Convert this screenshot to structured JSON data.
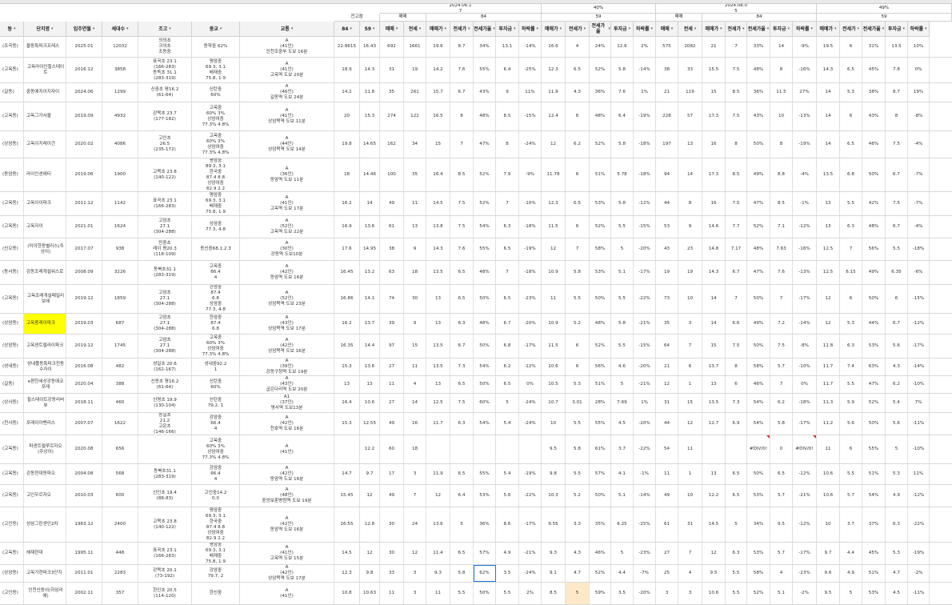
{
  "header": {
    "row1": {
      "date_left": "2024.06.1\n7",
      "pct_left": "40%",
      "date_right": "2024.08.0\n5",
      "pct_right": "49%"
    },
    "row2": {
      "unit": "전고점",
      "trade1": "매매",
      "v84a": "84",
      "v59a": "59",
      "trade2": "매매",
      "v84b": "84",
      "v59b": "59"
    },
    "columns": [
      "동",
      "단지명",
      "입주연월",
      "세대수",
      "조고",
      "중교",
      "교통",
      "84",
      "59",
      "매매",
      "전세",
      "매매가",
      "전세가",
      "전세가율",
      "투자금",
      "하락률",
      "매매가",
      "전세가",
      "전세가율",
      "투자금",
      "하락률",
      "매매",
      "전세",
      "매매가",
      "전세가",
      "전세가율",
      "투자금",
      "하락률",
      "매매가",
      "전세가",
      "전세가율",
      "투자금",
      "하락률"
    ]
  },
  "rows": [
    [
      "(조곡동)",
      "율동특파크프레스",
      "2025.01",
      "12032",
      "의의초\n크의초\n조동중",
      "동학중 62%",
      "A\n(41인)\n인천조중부 도보 16분",
      "22.8615",
      "16.43",
      "692",
      "1661",
      "19.6",
      "8.7",
      "34%",
      "13.1",
      "-14%",
      "16.6",
      "4",
      "24%",
      "12.6",
      "2%",
      "575",
      "2082",
      "21",
      "7",
      "33%",
      "14",
      "-9%",
      "19.5",
      "6",
      "31%",
      "13.5",
      "10%"
    ],
    [
      "(고옥동)",
      "고옥라이인힐스테이트",
      "2016.12",
      "3858",
      "표곡초 23.1\n(166-283)\n동독초 31.1\n(283-319)",
      "평암중\n69.3, 3.1\n배재중\n75.8, 1.9",
      "A\n(41인)\n고옥역 도보 20분",
      "18.9",
      "14.3",
      "31",
      "19",
      "14.2",
      "7.6",
      "55%",
      "6.4",
      "-25%",
      "12.3",
      "6.5",
      "52%",
      "5.8",
      "-14%",
      "38",
      "33",
      "15.5",
      "7.5",
      "48%",
      "8",
      "-16%",
      "14.3",
      "6.5",
      "45%",
      "7.8",
      "0%"
    ],
    [
      "(길동)",
      "중동예지이지자이",
      "2024.06",
      "1299",
      "신중초 평16.2\n(61-64)",
      "신탄중\n60%",
      "A\n(46인)\n길동역 도보 24분",
      "14.2",
      "11.8",
      "35",
      "261",
      "15.7",
      "6.7",
      "43%",
      "9",
      "11%",
      "11.9",
      "4.3",
      "36%",
      "7.6",
      "1%",
      "21",
      "119",
      "15",
      "8.5",
      "36%",
      "11.5",
      "27%",
      "14",
      "5.3",
      "38%",
      "8.7",
      "19%"
    ],
    [
      "(고옥동)",
      "고옥그가서울",
      "2019.09",
      "4932",
      "강목초 23.7\n(177-182)",
      "고옥중\n60% 3%\n상암여중\n77.3% 4.8%",
      "A\n(41인)\n상암목역 도보 11분",
      "20",
      "15.3",
      "274",
      "122",
      "16.5",
      "8",
      "48%",
      "8.5",
      "-15%",
      "12.4",
      "6",
      "48%",
      "6.4",
      "-19%",
      "228",
      "57",
      "17.3",
      "7.5",
      "43%",
      "10",
      "-13%",
      "14",
      "6",
      "43%",
      "8",
      "-8%"
    ],
    [
      "(상암동)",
      "고옥이지레이건",
      "2020.02",
      "4086",
      "고인초\n26.5\n(235-172)",
      "고옥중\n60% 3%\n상암여중\n77.3% 4.8%",
      "A\n(44인)\n상암목역 도보 14분",
      "19.8",
      "14.65",
      "162",
      "34",
      "15",
      "7",
      "47%",
      "8",
      "-24%",
      "12",
      "6.2",
      "52%",
      "5.8",
      "-18%",
      "197",
      "13",
      "16",
      "8",
      "50%",
      "8",
      "-19%",
      "14",
      "6.5",
      "46%",
      "7.5",
      "-4%"
    ],
    [
      "(동암동)",
      "라이인센에티",
      "2019.06",
      "1900",
      "고목초 23.8\n(140-122)",
      "평암중\n89.3, 3.1\n한국중\n87.4 8.8\n상암여중\n82.9 2.2",
      "A\n(36인)\n동암역 도보 11분",
      "18",
      "14.46",
      "100",
      "35",
      "16.4",
      "8.5",
      "52%",
      "7.9",
      "-9%",
      "11.78",
      "6",
      "51%",
      "5.78",
      "-18%",
      "94",
      "14",
      "17.3",
      "8.5",
      "49%",
      "8.8",
      "-4%",
      "13.5",
      "6.8",
      "50%",
      "6.7",
      "-7%"
    ],
    [
      "(고옥동)",
      "고옥이이파크",
      "2011.12",
      "1142",
      "표곡초 23.1\n(166-283)",
      "평암중\n69.3, 3.1\n배재중\n75.8, 1.9",
      "A\n(41인)\n고옥역 도보 17분",
      "16.2",
      "14",
      "49",
      "11",
      "14.5",
      "7.5",
      "52%",
      "7",
      "-10%",
      "12.3",
      "6.5",
      "53%",
      "5.8",
      "-12%",
      "44",
      "8",
      "16",
      "7.5",
      "47%",
      "8.5",
      "-1%",
      "13",
      "5.5",
      "42%",
      "7.5",
      "-7%"
    ],
    [
      "(고옥동)",
      "고옥자이",
      "2021.01",
      "1624",
      "고암초\n27.1\n(304-288)",
      "상암중\n77.3, 4.8",
      "A\n(52인)\n고옥역 도보 22분",
      "16.9",
      "13.6",
      "61",
      "13",
      "13.8",
      "7.5",
      "54%",
      "6.3",
      "-18%",
      "11.5",
      "6",
      "52%",
      "5.5",
      "-15%",
      "53",
      "9",
      "14.6",
      "7.7",
      "52%",
      "7.1",
      "-12%",
      "13",
      "6.3",
      "48%",
      "6.7",
      "-4%"
    ],
    [
      "(신오동)",
      "(미이한동별리스(주상이)",
      "2017.07",
      "938",
      "민중초\n레이 평20.3\n(118-109)",
      "동신중68.1,2.3",
      "A\n(30인)\n강동역 도보10분",
      "17.6",
      "14.95",
      "38",
      "9",
      "14.3",
      "7.6",
      "55%",
      "6.5",
      "-19%",
      "12",
      "7",
      "58%",
      "5",
      "-20%",
      "43",
      "23",
      "14.8",
      "7.17",
      "48%",
      "7.63",
      "-16%",
      "12.5",
      "7",
      "56%",
      "5.5",
      "-18%"
    ],
    [
      "(동사동)",
      "강동조례개설워스로",
      "2008.09",
      "3226",
      "동북초31.1\n(283-319)",
      "고옥중\n66.4\n4",
      "A\n(42인)\n동암역 도보 16분",
      "16.45",
      "13.2",
      "63",
      "18",
      "13.5",
      "6.5",
      "48%",
      "7",
      "-18%",
      "10.9",
      "5.8",
      "53%",
      "5.1",
      "-17%",
      "19",
      "19",
      "14.3",
      "6.7",
      "47%",
      "7.6",
      "-13%",
      "12.5",
      "6.15",
      "49%",
      "6.35",
      "-6%"
    ],
    [
      "(고옥동)",
      "고옥조례개설패밀리보에",
      "2019.12",
      "1859",
      "고암초\n27.1\n(304-288)",
      "한암중\n87.4\n6.8\n상암중\n77.3, 4.8",
      "A\n(52인)\n상암목역 도보 23분",
      "16.86",
      "14.1",
      "74",
      "30",
      "13",
      "6.5",
      "50%",
      "6.5",
      "-23%",
      "11",
      "5.5",
      "50%",
      "5.5",
      "-22%",
      "73",
      "10",
      "14",
      "7",
      "50%",
      "7",
      "-17%",
      "12",
      "6",
      "50%",
      "6",
      "-15%"
    ],
    [
      "(상암동)",
      "고옥종레이파크",
      "2019.03",
      "687",
      "고암초\n27.1\n(304-288)",
      "한암중\n87.4\n6.8",
      "A\n(43인)\n상암목역 도보 17분",
      "16.2",
      "13.7",
      "39",
      "9",
      "13",
      "6.3",
      "48%",
      "6.7",
      "-20%",
      "10.9",
      "5.2",
      "48%",
      "5.8",
      "-21%",
      "35",
      "3",
      "14",
      "6.6",
      "49%",
      "7.2",
      "-14%",
      "12",
      "5.3",
      "44%",
      "6.7",
      "-12%"
    ],
    [
      "(상암동)",
      "고옥센트럴라이파크",
      "2019.12",
      "1745",
      "고암초\n27.1\n(304-288)",
      "고옥중\n60% 3%\n상암여중\n77.3% 4.8%",
      "A\n(42인)\n상암목역 도보 16분",
      "16.35",
      "14.4",
      "97",
      "15",
      "13.5",
      "6.7",
      "50%",
      "6.8",
      "-17%",
      "11.5",
      "6",
      "52%",
      "5.5",
      "-15%",
      "64",
      "7",
      "15",
      "7.5",
      "50%",
      "7.5",
      "-8%",
      "11.8",
      "6.3",
      "53%",
      "5.6",
      "-17%"
    ],
    [
      "(성내동)",
      "성내플동특파크전동수자이",
      "2016.08",
      "482",
      "성일초 20.6\n(162-167)",
      "성내중92.2\n1",
      "A\n(39인)\n강동구청역 도보 19분",
      "15.3",
      "13.6",
      "27",
      "11",
      "13.5",
      "7.3",
      "54%",
      "6.2",
      "-12%",
      "10.6",
      "6",
      "56%",
      "4.6",
      "-20%",
      "21",
      "6",
      "13.7",
      "8",
      "58%",
      "5.7",
      "-10%",
      "11.7",
      "7.4",
      "63%",
      "4.3",
      "-14%"
    ],
    [
      "(길동)",
      "e편한세상강동에코포레",
      "2020.04",
      "388",
      "신동초 평16.2\n(61-64)",
      "신탄중\n60%",
      "A\n(43인)\n굽은다리역 도보 20분",
      "13",
      "13",
      "11",
      "4",
      "13",
      "6.5",
      "50%",
      "6.5",
      "0%",
      "10.5",
      "5.3",
      "51%",
      "5",
      "-21%",
      "12",
      "1",
      "13",
      "6",
      "46%",
      "7",
      "0%",
      "11.7",
      "5.5",
      "47%",
      "6.2",
      "-10%"
    ],
    [
      "(상사동)",
      "힐스테이트강동리버뷰",
      "2018.11",
      "460",
      "신명초 19.9\n(130-104)",
      "신탄중\n79.2, 1",
      "A1\n(37인)\n명사역 도보13분",
      "16.4",
      "10.6",
      "27",
      "14",
      "12.5",
      "7.5",
      "60%",
      "5",
      "-24%",
      "10.7",
      "3.01",
      "28%",
      "7.69",
      "1%",
      "31",
      "15",
      "13.5",
      "7.3",
      "54%",
      "6.2",
      "-18%",
      "11.3",
      "5.9",
      "52%",
      "5.4",
      "7%"
    ],
    [
      "(천사동)",
      "포레이아벤리스",
      "2007.07",
      "1622",
      "동일초\n21.2\n고운초\n(146-166)",
      "강암중\n66.4\n4",
      "A\n(42인)\n천호역 도보 16분",
      "15.3",
      "12.55",
      "49",
      "16",
      "11.7",
      "6.3",
      "54%",
      "5.4",
      "-24%",
      "10",
      "5.5",
      "55%",
      "4.5",
      "-20%",
      "44",
      "12",
      "12.7",
      "6.9",
      "54%",
      "5.8",
      "-17%",
      "11.2",
      "5.6",
      "50%",
      "5.6",
      "-11%"
    ],
    [
      "(고옥동)",
      "파센트럴루르자오(주상이)",
      "2020.08",
      "656",
      "",
      "고옥중\n60% 3%\n상암여중\n77.3% 4.8%",
      "A\n(41인)",
      "",
      "12.2",
      "60",
      "18",
      "",
      "",
      "",
      "",
      "",
      "9.5",
      "5.8",
      "61%",
      "3.7",
      "-22%",
      "54",
      "11",
      "",
      "",
      "#DIV/0!",
      "0",
      "#DIV/0!",
      "11",
      "6",
      "55%",
      "5",
      "-10%"
    ],
    [
      "(고옥동)",
      "강동현대동파오",
      "2004.08",
      "568",
      "동북초31.1\n(283-319)",
      "강암중\n66.4\n4",
      "A\n(42인)\n동암역 도보 16분",
      "14.7",
      "9.7",
      "17",
      "3",
      "11.9",
      "6.5",
      "55%",
      "5.4",
      "-19%",
      "9.8",
      "5.5",
      "57%",
      "4.1",
      "-1%",
      "11",
      "1",
      "13",
      "6.5",
      "50%",
      "6.5",
      "-12%",
      "10.6",
      "5.5",
      "51%",
      "5.3",
      "11%"
    ],
    [
      "(고옥동)",
      "고인우르자오",
      "2010.03",
      "600",
      "신인초 19.4\n(88-83)",
      "고인중14.2\n0.0",
      "A\n(48인)\n중앙보훈병원역 도보 19분",
      "15.45",
      "12",
      "49",
      "7",
      "12",
      "6.4",
      "53%",
      "5.6",
      "-22%",
      "10.3",
      "5.2",
      "50%",
      "5.1",
      "-14%",
      "49",
      "10",
      "12.2",
      "6.5",
      "53%",
      "5.7",
      "-21%",
      "10.6",
      "5.7",
      "54%",
      "4.9",
      "-12%"
    ],
    [
      "(고인동)",
      "성삼그린센인2차",
      "1983.12",
      "2400",
      "고목초 23.8\n(140-122)",
      "평암중\n69.3, 3.1\n한국중\n87.4 8.8\n상암여중\n82.9 2.2",
      "A\n(42인)\n동암역 도보 16분",
      "16.55",
      "12.8",
      "30",
      "24",
      "13.6",
      "5",
      "36%",
      "8.6",
      "-17%",
      "9.55",
      "3.3",
      "35%",
      "6.25",
      "-25%",
      "61",
      "31",
      "14.5",
      "5",
      "34%",
      "9.5",
      "-12%",
      "10",
      "3.7",
      "37%",
      "6.3",
      "-22%"
    ],
    [
      "(고옥동)",
      "해재현대",
      "1995.11",
      "448",
      "표곡초 23.1\n(166-283)",
      "평암중\n69.3, 3.1\n배재중\n75.8, 1.9",
      "A\n(41인)\n고옥역 도보 15분",
      "14.5",
      "12",
      "30",
      "12",
      "11.4",
      "6.5",
      "57%",
      "4.9",
      "-21%",
      "9.3",
      "4.3",
      "46%",
      "5",
      "-23%",
      "27",
      "7",
      "12",
      "6.3",
      "53%",
      "5.7",
      "-17%",
      "9.7",
      "4.4",
      "45%",
      "5.3",
      "-19%"
    ],
    [
      "(상암동)",
      "고옥가현파크3단지",
      "2011.01",
      "2283",
      "강목초 20.1\n(73-192)",
      "강암중\n79.7, 2",
      "A\n(42인)\n상암목역 도보 17분",
      "12.3",
      "9.8",
      "33",
      "3",
      "9.3",
      "5.8",
      "62%",
      "3.5",
      "-24%",
      "9.1",
      "4.7",
      "52%",
      "4.4",
      "-7%",
      "25",
      "4",
      "9.5",
      "5.5",
      "58%",
      "4",
      "-23%",
      "9.6",
      "4.9",
      "51%",
      "4.7",
      "-2%"
    ],
    [
      "(고인동)",
      "인천신동이(하임리에)",
      "2002.11",
      "357",
      "한인초 20.5\n(114-120)",
      "한신중",
      "A\n(41인)",
      "10.8",
      "10.63",
      "11",
      "3",
      "11",
      "5.5",
      "50%",
      "5.5",
      "2%",
      "8.5",
      "5",
      "59%",
      "3.5",
      "-20%",
      "3",
      "3",
      "10.6",
      "5.5",
      "52%",
      "5.1",
      "-2%",
      "9.5",
      "5",
      "53%",
      "4.5",
      "-11%"
    ]
  ],
  "colors": {
    "grid": "#d8d8d8",
    "highlight_yellow": "#ffff00",
    "highlight_blue": "#1a73e8",
    "highlight_peach": "#fde9c8",
    "error_tick": "#dd3333"
  }
}
